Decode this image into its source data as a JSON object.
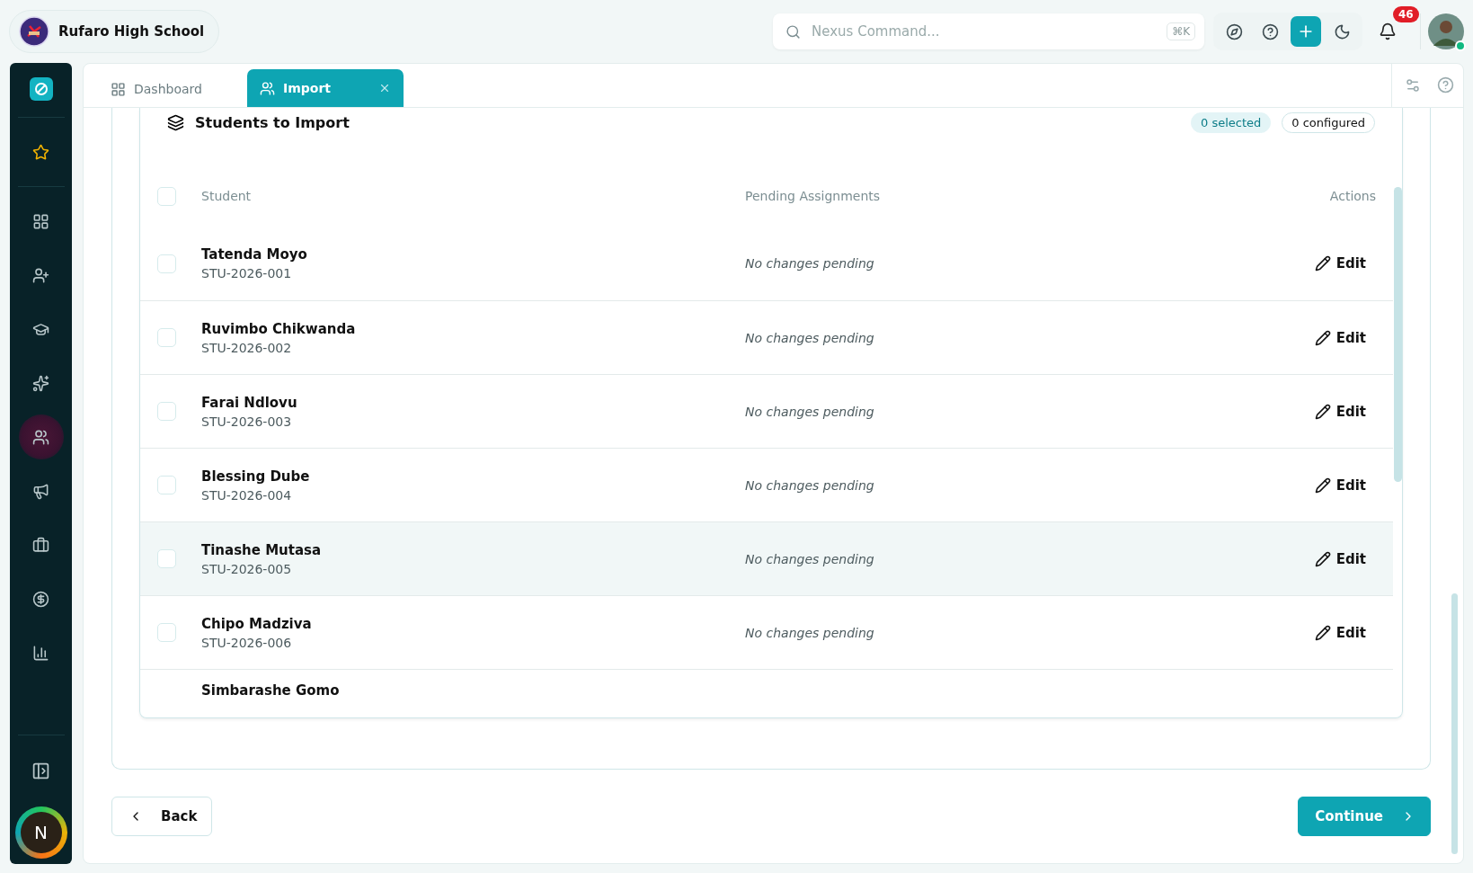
{
  "header": {
    "school": "Rufaro High School",
    "search": {
      "placeholder": "Nexus Command...",
      "shortcut": "⌘K"
    },
    "notifications": "46"
  },
  "sidebar": {
    "items": [
      {
        "selected": false
      },
      {
        "selected": false
      },
      {
        "selected": false
      },
      {
        "selected": false
      },
      {
        "selected": false
      },
      {
        "selected": true
      },
      {
        "selected": false
      },
      {
        "selected": false
      },
      {
        "selected": false
      },
      {
        "selected": false
      }
    ],
    "profile": "N"
  },
  "tabs": [
    {
      "label": "Dashboard",
      "selected": false
    },
    {
      "label": "Import",
      "selected": true
    }
  ],
  "panel": {
    "title": "Students to Import",
    "badges": [
      {
        "label": "0 selected",
        "kind": "tinted"
      },
      {
        "label": "0 configured",
        "kind": "outlined"
      }
    ]
  },
  "table": {
    "columns": [
      "Student",
      "Pending Assignments",
      "Actions"
    ],
    "all_checked": false,
    "rows": [
      {
        "name": "Tatenda Moyo",
        "id": "STU-2026-001",
        "pending": "No changes pending",
        "action": "Edit",
        "checked": false,
        "highlighted": false
      },
      {
        "name": "Ruvimbo Chikwanda",
        "id": "STU-2026-002",
        "pending": "No changes pending",
        "action": "Edit",
        "checked": false,
        "highlighted": false
      },
      {
        "name": "Farai Ndlovu",
        "id": "STU-2026-003",
        "pending": "No changes pending",
        "action": "Edit",
        "checked": false,
        "highlighted": false
      },
      {
        "name": "Blessing Dube",
        "id": "STU-2026-004",
        "pending": "No changes pending",
        "action": "Edit",
        "checked": false,
        "highlighted": false
      },
      {
        "name": "Tinashe Mutasa",
        "id": "STU-2026-005",
        "pending": "No changes pending",
        "action": "Edit",
        "checked": false,
        "highlighted": true
      },
      {
        "name": "Chipo Madziva",
        "id": "STU-2026-006",
        "pending": "No changes pending",
        "action": "Edit",
        "checked": false,
        "highlighted": false
      }
    ],
    "partial_row": {
      "name": "Simbarashe Gomo"
    }
  },
  "footer": {
    "back": "Back",
    "continue": "Continue"
  }
}
